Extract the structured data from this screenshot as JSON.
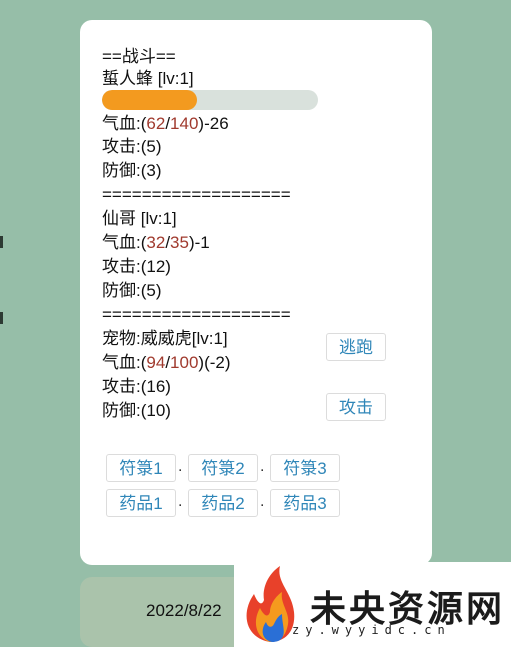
{
  "battle": {
    "header": "==战斗==",
    "enemy": {
      "name": "蜇人蜂 [lv:1]",
      "hp_fraction": 0.44,
      "hp_label": "气血:(",
      "hp_current": "62",
      "hp_slash": "/",
      "hp_max": "140",
      "hp_suffix": ")-26",
      "attack": "攻击:(5)",
      "defense": "防御:(3)"
    },
    "divider": "===================",
    "player": {
      "name": "仙哥 [lv:1]",
      "hp_label": "气血:(",
      "hp_current": "32",
      "hp_slash": "/",
      "hp_max": "35",
      "hp_suffix": ")-1",
      "attack": "攻击:(12)",
      "defense": "防御:(5)"
    },
    "pet": {
      "name": "宠物:威威虎[lv:1]",
      "hp_label": "气血:(",
      "hp_current": "94",
      "hp_slash": "/",
      "hp_max": "100",
      "hp_suffix": ")(-2)",
      "attack": "攻击:(16)",
      "defense": "防御:(10)"
    },
    "actions": {
      "flee": "逃跑",
      "attack": "攻击"
    },
    "talismans": [
      "符箓1",
      "符箓2",
      "符箓3"
    ],
    "potions": [
      "药品1",
      "药品2",
      "药品3"
    ],
    "separator": "."
  },
  "footer": {
    "date": "2022/8/22"
  },
  "watermark": {
    "text": "未央资源网",
    "url": "zy.wyyidc.cn"
  },
  "colors": {
    "hp_bar": "#f39a1f",
    "hp_track": "#d9e1dc",
    "link": "#2f86b8",
    "hp_number": "#a03a2e"
  }
}
